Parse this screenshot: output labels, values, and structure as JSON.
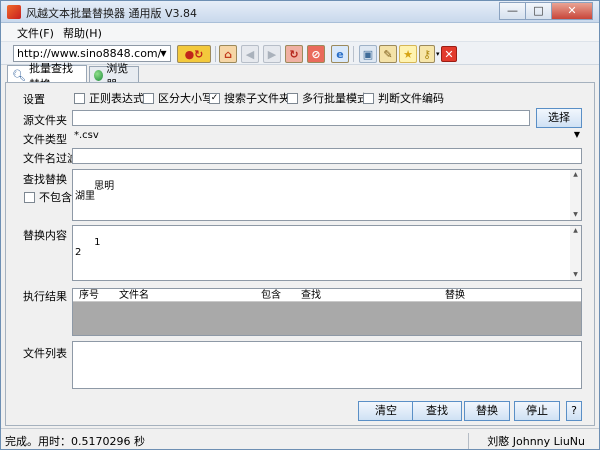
{
  "window": {
    "title": "风越文本批量替换器 通用版 V3.84",
    "min": "—",
    "max": "□",
    "close": "✕"
  },
  "menu": [
    {
      "label": "文件(F)"
    },
    {
      "label": "帮助(H)"
    }
  ],
  "toolbar": {
    "url": "http://www.sino8848.com/",
    "buttons": [
      "home-icon",
      "back-icon",
      "forward-icon",
      "refresh-icon",
      "stop-icon",
      "ie-icon",
      "window-icon",
      "dropper-icon",
      "favorite-icon",
      "key-icon",
      "close-icon"
    ]
  },
  "tabs": [
    {
      "label": "批量查找替换",
      "active": true
    },
    {
      "label": "浏览器",
      "active": false
    }
  ],
  "form": {
    "settings_label": "设置",
    "options": [
      {
        "label": "正则表达式",
        "checked": false
      },
      {
        "label": "区分大小写",
        "checked": false
      },
      {
        "label": "搜索子文件夹",
        "checked": true
      },
      {
        "label": "多行批量模式",
        "checked": false
      },
      {
        "label": "判断文件编码",
        "checked": false
      }
    ],
    "source_label": "源文件夹",
    "source_value": "",
    "choose_label": "选择",
    "filetype_label": "文件类型",
    "filetype_value": "*.csv",
    "filter_label": "文件名过滤",
    "filter_value": "",
    "find_label": "查找替换",
    "not_contain_label": "不包含",
    "find_value": "思明\n湖里",
    "replace_label": "替换内容",
    "replace_value": "1\n2",
    "result_label": "执行结果",
    "result_columns": [
      "序号",
      "文件名",
      "包含",
      "查找",
      "替换"
    ],
    "filelist_label": "文件列表",
    "filelist_value": ""
  },
  "actions": {
    "clear": "清空",
    "find": "查找",
    "replace": "替换",
    "stop": "停止",
    "help": "?"
  },
  "status": {
    "text": "完成。用时：0.5170296 秒",
    "author": "刘憨 Johnny LiuNu"
  }
}
